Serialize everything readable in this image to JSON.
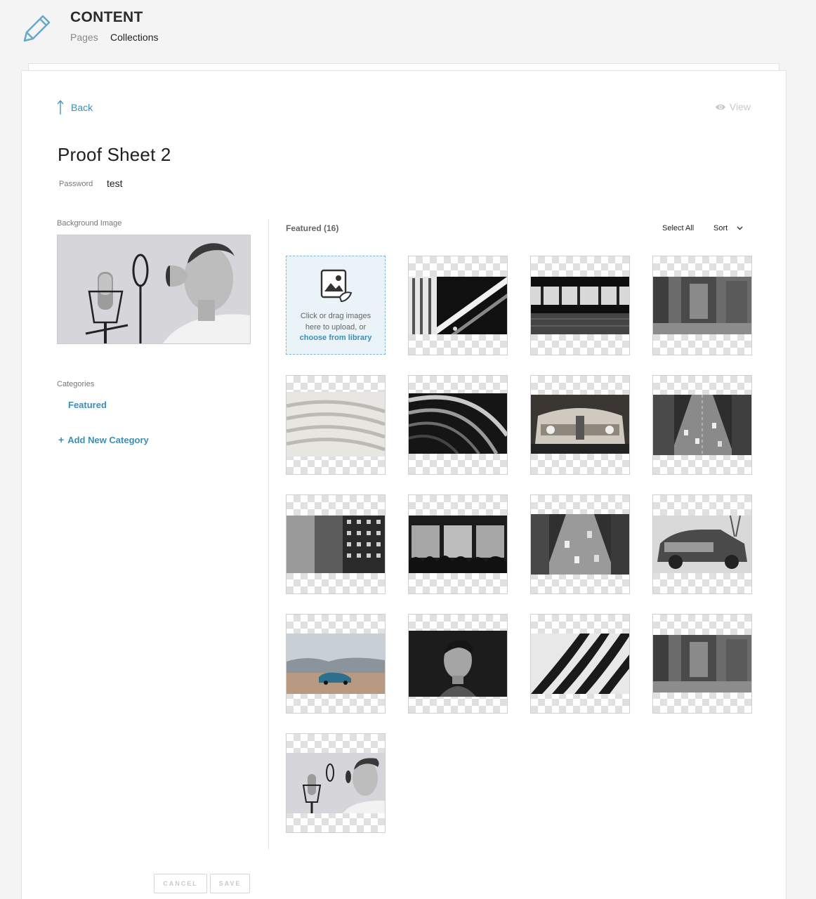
{
  "header": {
    "title": "CONTENT",
    "nav": {
      "pages": "Pages",
      "collections": "Collections"
    },
    "icon": "pencil-icon",
    "accent": "#3c8eb7"
  },
  "toolbar": {
    "back_label": "Back",
    "view_label": "View"
  },
  "collection": {
    "title": "Proof Sheet 2",
    "password_label": "Password",
    "password_value": "test"
  },
  "sidebar": {
    "background_label": "Background Image",
    "categories_label": "Categories",
    "categories": [
      "Featured"
    ],
    "add_category_label": "Add New Category"
  },
  "gallery": {
    "title": "Featured (16)",
    "select_all_label": "Select All",
    "sort_label": "Sort",
    "upload": {
      "line1": "Click or drag images",
      "line2": "here to upload, or",
      "link": "choose from library"
    }
  },
  "footer": {
    "cancel_label": "CANCEL",
    "save_label": "SAVE"
  }
}
